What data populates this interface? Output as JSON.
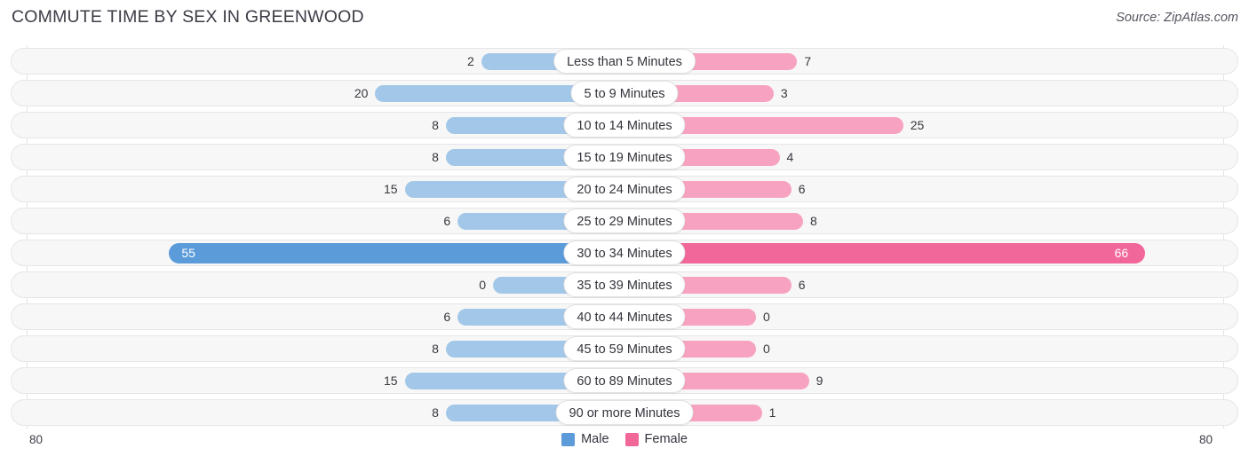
{
  "header": {
    "title": "COMMUTE TIME BY SEX IN GREENWOOD",
    "source": "Source: ZipAtlas.com"
  },
  "axis": {
    "left_label": "80",
    "right_label": "80"
  },
  "legend": {
    "items": [
      {
        "label": "Male",
        "color": "#5b9bd9"
      },
      {
        "label": "Female",
        "color": "#f2679a"
      }
    ]
  },
  "colors": {
    "male_light": "#a3c7e8",
    "female_light": "#f7a2c0",
    "male_strong": "#5b9bd9",
    "female_strong": "#f2679a",
    "track": "#f7f7f7",
    "grid": "#e3e3e6"
  },
  "chart_data": {
    "type": "bar",
    "subtype": "diverging-bidirectional",
    "title": "COMMUTE TIME BY SEX IN GREENWOOD",
    "xlabel": "",
    "ylabel": "",
    "xlim": [
      80,
      80
    ],
    "axis_max": 80,
    "grid": true,
    "legend_position": "bottom-center",
    "categories": [
      "Less than 5 Minutes",
      "5 to 9 Minutes",
      "10 to 14 Minutes",
      "15 to 19 Minutes",
      "20 to 24 Minutes",
      "25 to 29 Minutes",
      "30 to 34 Minutes",
      "35 to 39 Minutes",
      "40 to 44 Minutes",
      "45 to 59 Minutes",
      "60 to 89 Minutes",
      "90 or more Minutes"
    ],
    "series": [
      {
        "name": "Male",
        "color": "#5b9bd9",
        "values": [
          2,
          20,
          8,
          8,
          15,
          6,
          55,
          0,
          6,
          8,
          15,
          8
        ]
      },
      {
        "name": "Female",
        "color": "#f2679a",
        "values": [
          7,
          3,
          25,
          4,
          6,
          8,
          66,
          6,
          0,
          0,
          9,
          1
        ]
      }
    ],
    "highlighted_category": "30 to 34 Minutes"
  },
  "rows": [
    {
      "label": "Less than 5 Minutes",
      "male": "2",
      "female": "7",
      "highlight": false
    },
    {
      "label": "5 to 9 Minutes",
      "male": "20",
      "female": "3",
      "highlight": false
    },
    {
      "label": "10 to 14 Minutes",
      "male": "8",
      "female": "25",
      "highlight": false
    },
    {
      "label": "15 to 19 Minutes",
      "male": "8",
      "female": "4",
      "highlight": false
    },
    {
      "label": "20 to 24 Minutes",
      "male": "15",
      "female": "6",
      "highlight": false
    },
    {
      "label": "25 to 29 Minutes",
      "male": "6",
      "female": "8",
      "highlight": false
    },
    {
      "label": "30 to 34 Minutes",
      "male": "55",
      "female": "66",
      "highlight": true
    },
    {
      "label": "35 to 39 Minutes",
      "male": "0",
      "female": "6",
      "highlight": false
    },
    {
      "label": "40 to 44 Minutes",
      "male": "6",
      "female": "0",
      "highlight": false
    },
    {
      "label": "45 to 59 Minutes",
      "male": "8",
      "female": "0",
      "highlight": false
    },
    {
      "label": "60 to 89 Minutes",
      "male": "15",
      "female": "9",
      "highlight": false
    },
    {
      "label": "90 or more Minutes",
      "male": "8",
      "female": "1",
      "highlight": false
    }
  ]
}
